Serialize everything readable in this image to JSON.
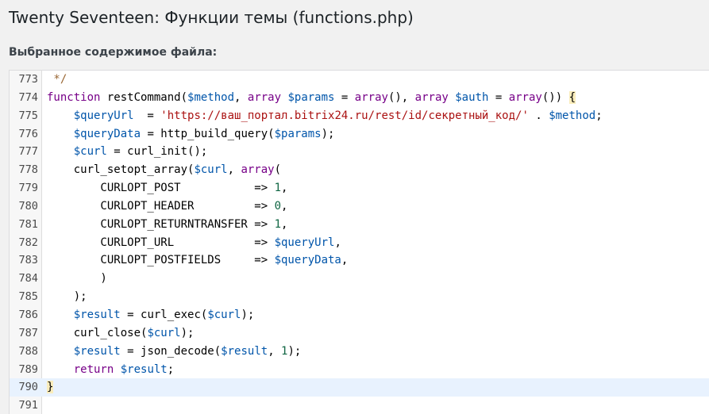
{
  "page": {
    "title": "Twenty Seventeen: Функции темы (functions.php)",
    "selected_content_label": "Выбранное содержимое файла:"
  },
  "editor": {
    "active_line": 790,
    "lines": [
      {
        "number": "773",
        "tokens": [
          {
            "t": " */",
            "k": "comment"
          }
        ]
      },
      {
        "number": "774",
        "tokens": [
          {
            "t": "function ",
            "k": "keyword"
          },
          {
            "t": "restCommand",
            "k": "plain"
          },
          {
            "t": "(",
            "k": "plain"
          },
          {
            "t": "$method",
            "k": "variable"
          },
          {
            "t": ", ",
            "k": "plain"
          },
          {
            "t": "array ",
            "k": "keyword"
          },
          {
            "t": "$params",
            "k": "variable"
          },
          {
            "t": " = ",
            "k": "plain"
          },
          {
            "t": "array",
            "k": "keyword"
          },
          {
            "t": "(), ",
            "k": "plain"
          },
          {
            "t": "array ",
            "k": "keyword"
          },
          {
            "t": "$auth",
            "k": "variable"
          },
          {
            "t": " = ",
            "k": "plain"
          },
          {
            "t": "array",
            "k": "keyword"
          },
          {
            "t": "()) ",
            "k": "plain"
          },
          {
            "t": "{",
            "k": "bracket-match"
          }
        ]
      },
      {
        "number": "775",
        "tokens": [
          {
            "t": "    ",
            "k": "plain"
          },
          {
            "t": "$queryUrl",
            "k": "variable"
          },
          {
            "t": "  = ",
            "k": "plain"
          },
          {
            "t": "'https://ваш_портал.bitrix24.ru/rest/id/секретный_код/'",
            "k": "string"
          },
          {
            "t": " . ",
            "k": "plain"
          },
          {
            "t": "$method",
            "k": "variable"
          },
          {
            "t": ";",
            "k": "plain"
          }
        ]
      },
      {
        "number": "776",
        "tokens": [
          {
            "t": "    ",
            "k": "plain"
          },
          {
            "t": "$queryData",
            "k": "variable"
          },
          {
            "t": " = http_build_query(",
            "k": "plain"
          },
          {
            "t": "$params",
            "k": "variable"
          },
          {
            "t": ");",
            "k": "plain"
          }
        ]
      },
      {
        "number": "777",
        "tokens": [
          {
            "t": "    ",
            "k": "plain"
          },
          {
            "t": "$curl",
            "k": "variable"
          },
          {
            "t": " = curl_init();",
            "k": "plain"
          }
        ]
      },
      {
        "number": "778",
        "tokens": [
          {
            "t": "    curl_setopt_array(",
            "k": "plain"
          },
          {
            "t": "$curl",
            "k": "variable"
          },
          {
            "t": ", ",
            "k": "plain"
          },
          {
            "t": "array",
            "k": "keyword"
          },
          {
            "t": "(",
            "k": "plain"
          }
        ]
      },
      {
        "number": "779",
        "tokens": [
          {
            "t": "        CURLOPT_POST           => ",
            "k": "plain"
          },
          {
            "t": "1",
            "k": "number"
          },
          {
            "t": ",",
            "k": "plain"
          }
        ]
      },
      {
        "number": "780",
        "tokens": [
          {
            "t": "        CURLOPT_HEADER         => ",
            "k": "plain"
          },
          {
            "t": "0",
            "k": "number"
          },
          {
            "t": ",",
            "k": "plain"
          }
        ]
      },
      {
        "number": "781",
        "tokens": [
          {
            "t": "        CURLOPT_RETURNTRANSFER => ",
            "k": "plain"
          },
          {
            "t": "1",
            "k": "number"
          },
          {
            "t": ",",
            "k": "plain"
          }
        ]
      },
      {
        "number": "782",
        "tokens": [
          {
            "t": "        CURLOPT_URL            => ",
            "k": "plain"
          },
          {
            "t": "$queryUrl",
            "k": "variable"
          },
          {
            "t": ",",
            "k": "plain"
          }
        ]
      },
      {
        "number": "783",
        "tokens": [
          {
            "t": "        CURLOPT_POSTFIELDS     => ",
            "k": "plain"
          },
          {
            "t": "$queryData",
            "k": "variable"
          },
          {
            "t": ",",
            "k": "plain"
          }
        ]
      },
      {
        "number": "784",
        "tokens": [
          {
            "t": "        )",
            "k": "plain"
          }
        ]
      },
      {
        "number": "785",
        "tokens": [
          {
            "t": "    );",
            "k": "plain"
          }
        ]
      },
      {
        "number": "786",
        "tokens": [
          {
            "t": "    ",
            "k": "plain"
          },
          {
            "t": "$result",
            "k": "variable"
          },
          {
            "t": " = curl_exec(",
            "k": "plain"
          },
          {
            "t": "$curl",
            "k": "variable"
          },
          {
            "t": ");",
            "k": "plain"
          }
        ]
      },
      {
        "number": "787",
        "tokens": [
          {
            "t": "    curl_close(",
            "k": "plain"
          },
          {
            "t": "$curl",
            "k": "variable"
          },
          {
            "t": ");",
            "k": "plain"
          }
        ]
      },
      {
        "number": "788",
        "tokens": [
          {
            "t": "    ",
            "k": "plain"
          },
          {
            "t": "$result",
            "k": "variable"
          },
          {
            "t": " = json_decode(",
            "k": "plain"
          },
          {
            "t": "$result",
            "k": "variable"
          },
          {
            "t": ", ",
            "k": "plain"
          },
          {
            "t": "1",
            "k": "number"
          },
          {
            "t": ");",
            "k": "plain"
          }
        ]
      },
      {
        "number": "789",
        "tokens": [
          {
            "t": "    ",
            "k": "plain"
          },
          {
            "t": "return ",
            "k": "keyword"
          },
          {
            "t": "$result",
            "k": "variable"
          },
          {
            "t": ";",
            "k": "plain"
          }
        ]
      },
      {
        "number": "790",
        "tokens": [
          {
            "t": "}",
            "k": "bracket-match"
          }
        ]
      },
      {
        "number": "791",
        "tokens": []
      }
    ]
  },
  "colors": {
    "background": "#f1f1f1",
    "editor_bg": "#ffffff",
    "gutter_bg": "#f7f7f7",
    "active_line": "#e8f2fe",
    "keyword": "#770088",
    "variable": "#0055aa",
    "string": "#aa1111",
    "number": "#116644",
    "comment": "#996633",
    "bracket_match": "#faedbc"
  }
}
